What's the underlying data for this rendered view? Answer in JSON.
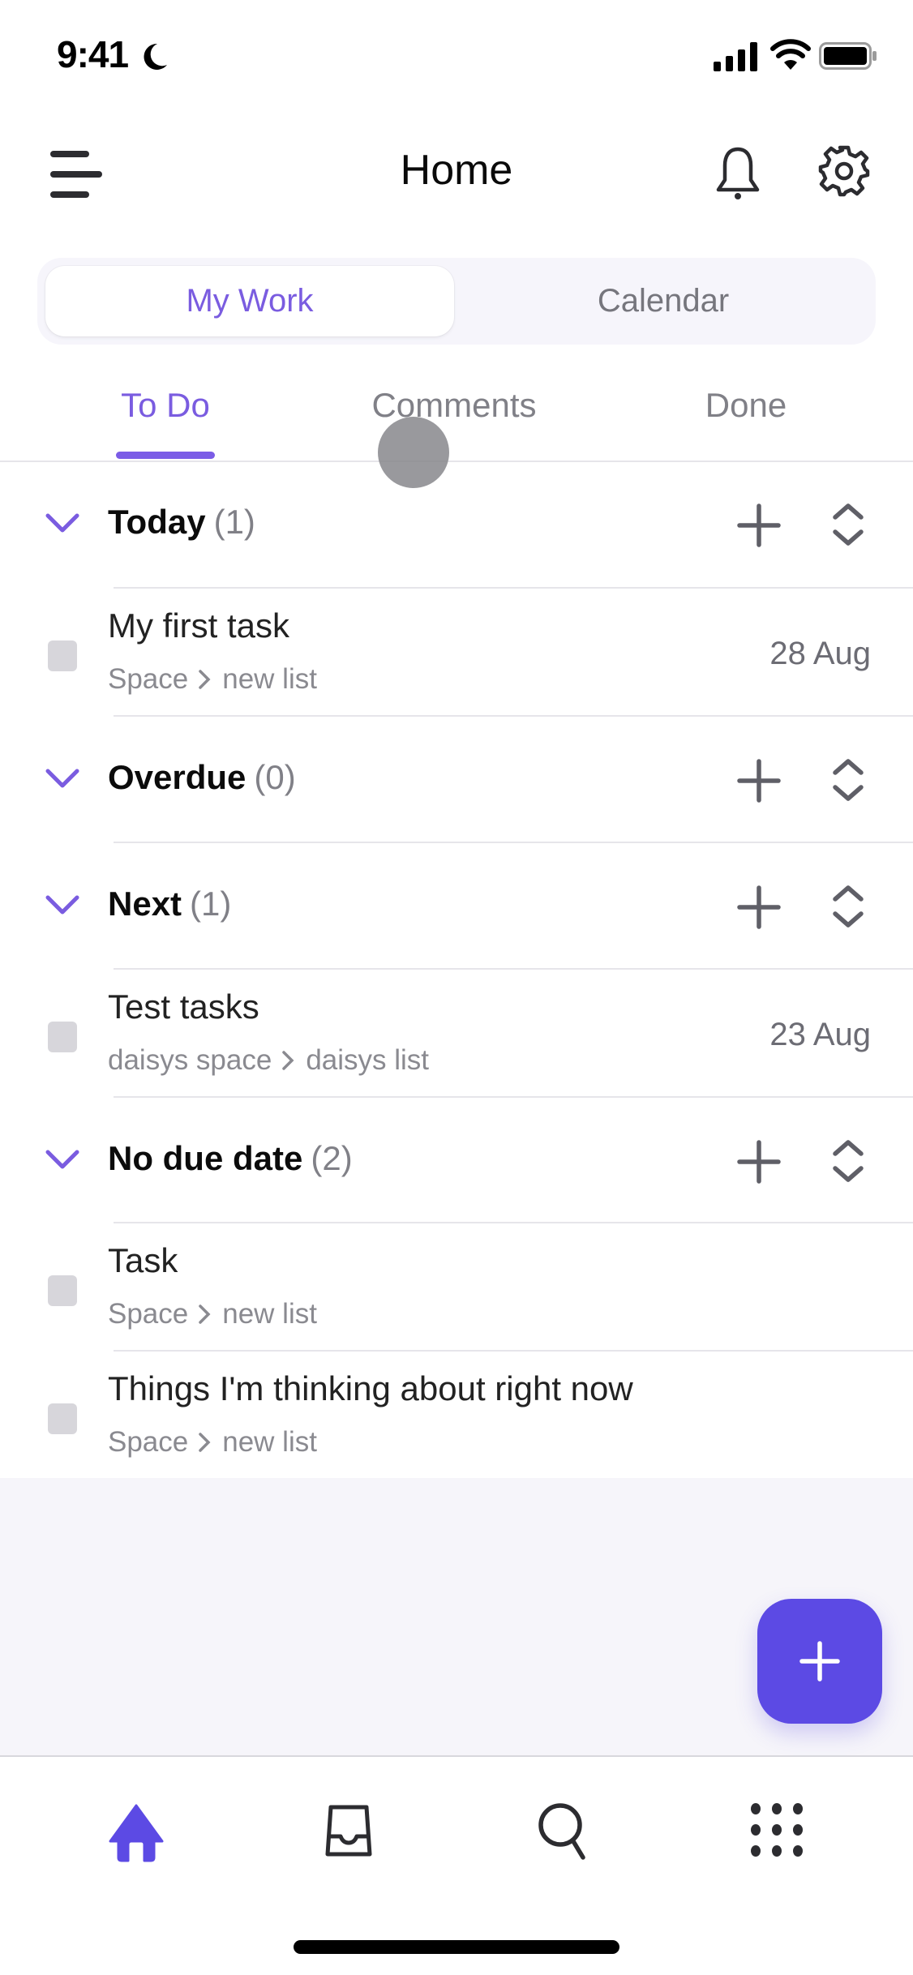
{
  "status_bar": {
    "time": "9:41",
    "icons": [
      "moon-icon",
      "cellular-signal-icon",
      "wifi-icon",
      "battery-icon"
    ]
  },
  "header": {
    "title": "Home",
    "left_icon": "menu-icon",
    "right_icons": [
      "bell-icon",
      "gear-icon"
    ]
  },
  "segmented_control": {
    "options": [
      {
        "label": "My Work",
        "selected": true
      },
      {
        "label": "Calendar",
        "selected": false
      }
    ]
  },
  "tabs": [
    {
      "label": "To Do",
      "active": true
    },
    {
      "label": "Comments",
      "active": false
    },
    {
      "label": "Done",
      "active": false
    }
  ],
  "sections": [
    {
      "title": "Today",
      "count": "(1)",
      "tasks": [
        {
          "title": "My first task",
          "space": "Space",
          "list": "new list",
          "date": "28 Aug"
        }
      ]
    },
    {
      "title": "Overdue",
      "count": "(0)",
      "tasks": []
    },
    {
      "title": "Next",
      "count": "(1)",
      "tasks": [
        {
          "title": "Test tasks",
          "space": "daisys space ",
          "list": "daisys list",
          "date": "23 Aug"
        }
      ]
    },
    {
      "title": "No due date",
      "count": "(2)",
      "tasks": [
        {
          "title": "Task",
          "space": "Space",
          "list": "new list",
          "date": ""
        },
        {
          "title": "Things I'm thinking about right now",
          "space": "Space",
          "list": "new list",
          "date": ""
        }
      ]
    }
  ],
  "fab": {
    "icon": "plus-icon"
  },
  "bottom_nav": {
    "items": [
      {
        "icon": "home-icon",
        "active": true
      },
      {
        "icon": "inbox-icon",
        "active": false
      },
      {
        "icon": "search-icon",
        "active": false
      },
      {
        "icon": "apps-grid-icon",
        "active": false
      }
    ]
  },
  "colors": {
    "accent": "#7a5ce0",
    "fab": "#5c4ae4",
    "muted_text": "#808087",
    "divider": "#e6e5ea",
    "empty_area": "#f6f5fa"
  }
}
